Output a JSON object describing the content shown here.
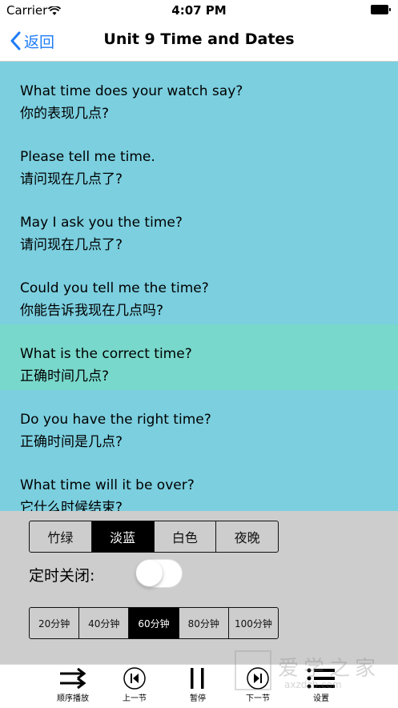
{
  "status_bar": {
    "carrier": "Carrier",
    "time": "4:07 PM"
  },
  "nav": {
    "back_label": "返回",
    "title": "Unit 9 Time and Dates"
  },
  "sentences": [
    {
      "en": "What time does your watch say?",
      "cn": "你的表现几点?"
    },
    {
      "en": "Please tell me time.",
      "cn": "请问现在几点了?"
    },
    {
      "en": "May I ask you the time?",
      "cn": "请问现在几点了?"
    },
    {
      "en": "Could you tell me the time?",
      "cn": "你能告诉我现在几点吗?"
    },
    {
      "en": "What is the correct time?",
      "cn": "正确时间几点?"
    },
    {
      "en": "Do you have the right time?",
      "cn": "正确时间是几点?"
    },
    {
      "en": "What time will it be over?",
      "cn": "它什么时候结束?"
    }
  ],
  "highlighted_index": 4,
  "theme": {
    "options": [
      "竹绿",
      "淡蓝",
      "白色",
      "夜晚"
    ],
    "selected": "淡蓝"
  },
  "timer": {
    "label": "定时关闭:",
    "enabled": false,
    "options": [
      "20分钟",
      "40分钟",
      "60分钟",
      "80分钟",
      "100分钟"
    ],
    "selected": "60分钟"
  },
  "toolbar": {
    "order_label": "顺序播放",
    "prev_label": "上一节",
    "pause_label": "暂停",
    "next_label": "下一节",
    "settings_label": "设置"
  },
  "watermark": {
    "text": "爱学之家",
    "url": "axzdzb.com"
  },
  "colors": {
    "accent": "#1e7cf6",
    "list_background": "#7bcfdf",
    "highlight_background": "#78d8cb",
    "panel_background": "#cdcdcd"
  }
}
